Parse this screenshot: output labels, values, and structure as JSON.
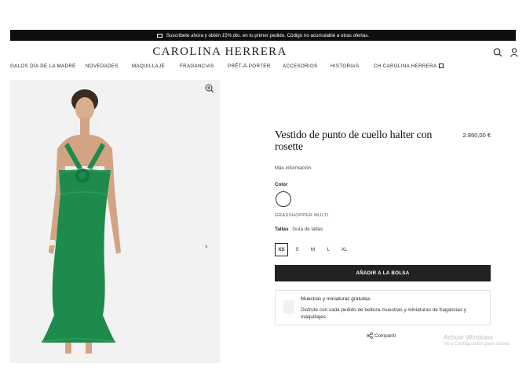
{
  "promo_bar": {
    "text": "Suscríbete ahora y obtén 15% dto. en tu primer pedido. Código no acumulable a otras ofertas."
  },
  "brand": {
    "logo": "CAROLINA HERRERA"
  },
  "nav": {
    "items": [
      "GALOS DÍA DE LA MADRE",
      "NOVEDADES",
      "MAQUILLAJE",
      "FRAGANCIAS",
      "PRÊT-À-PORTER",
      "ACCESORIOS",
      "HISTORIAS",
      "CH CAROLINA HERRERA"
    ]
  },
  "product": {
    "title": "Vestido de punto de cuello halter con rosette",
    "price": "2.950,00 €",
    "more_info": "Más información",
    "color_label": "Color",
    "color_name": "GRASSHOPPER MULTI",
    "sizes_label": "Tallas",
    "size_guide": "Guía de tallas",
    "sizes": [
      "XS",
      "S",
      "M",
      "L",
      "XL"
    ],
    "selected_size": "XS",
    "add_to_bag": "AÑADIR A LA BOLSA",
    "dress_color": "#1e8a4c"
  },
  "samples": {
    "title": "Muestras y miniaturas gratuitas",
    "description": "Disfrute con cada pedido de belleza muestras y miniaturas de fragancias y maquillajes."
  },
  "share": {
    "label": "Compartir"
  },
  "os_watermark": {
    "line1": "Activar Windows",
    "line2": "Ve a Configuración para activar"
  }
}
